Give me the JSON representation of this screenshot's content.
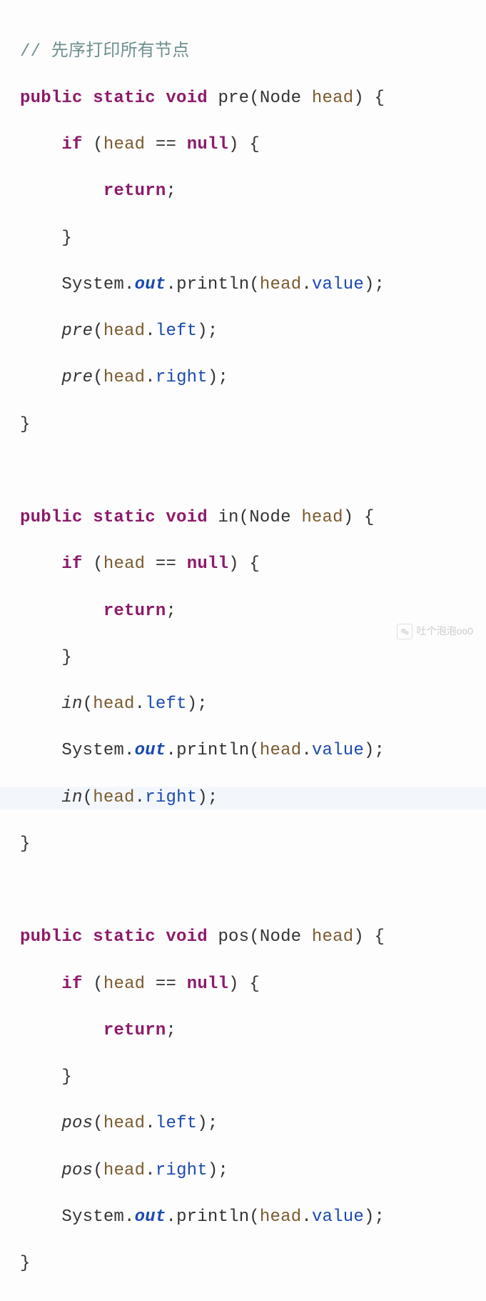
{
  "code": {
    "c1": "// 先序打印所有节点",
    "m1": {
      "kw": "public static void",
      "name": "pre",
      "type": "Node",
      "param": "head"
    },
    "m2": {
      "kw": "public static void",
      "name": "in",
      "type": "Node",
      "param": "head"
    },
    "m3": {
      "kw": "public static void",
      "name": "pos",
      "type": "Node",
      "param": "head"
    },
    "if": "if",
    "null": "null",
    "return": "return",
    "head": "head",
    "System": "System",
    "out": "out",
    "println": "println",
    "value": "value",
    "left": "left",
    "right": "right",
    "pre_call": "pre",
    "in_call": "in",
    "pos_call": "pos",
    "eq": "=="
  },
  "watermark": "吐个泡泡oo0"
}
